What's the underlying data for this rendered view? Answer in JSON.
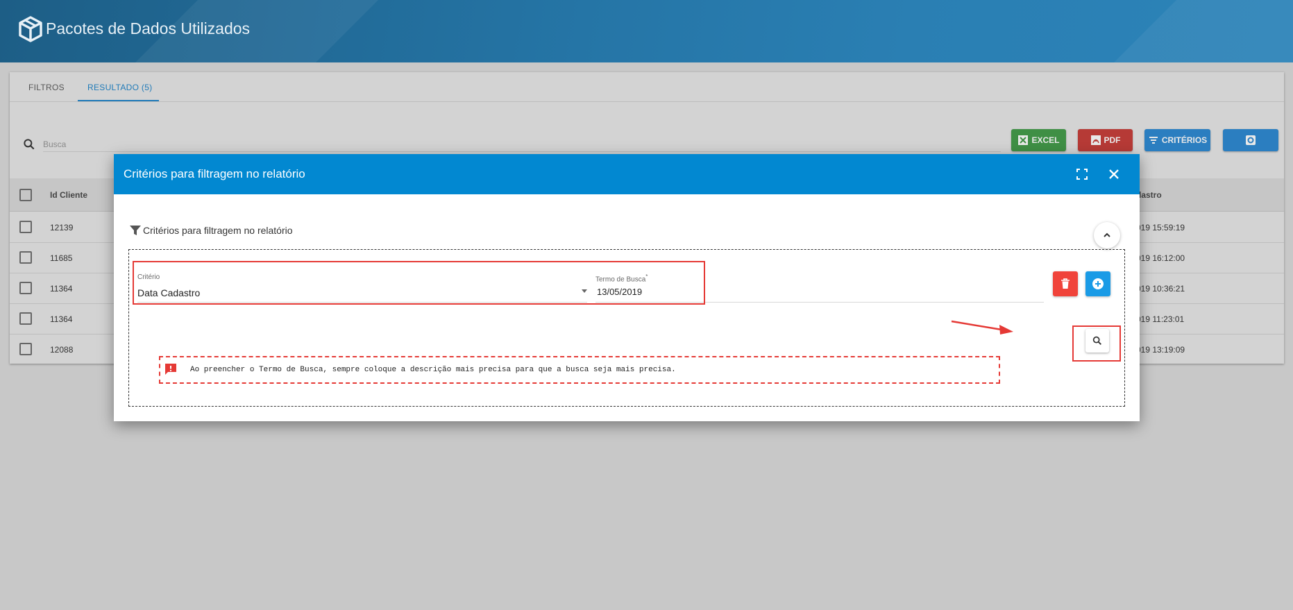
{
  "header": {
    "title": "Pacotes de Dados Utilizados",
    "logo_icon": "box-icon"
  },
  "tabs": [
    {
      "label": "FILTROS",
      "active": false
    },
    {
      "label": "RESULTADO (5)",
      "active": true
    }
  ],
  "search": {
    "placeholder": "Busca"
  },
  "toolbar": {
    "excel_label": "EXCEL",
    "pdf_label": "PDF",
    "criterios_label": "CRITÉRIOS",
    "colors": {
      "excel": "#3f8f45",
      "pdf": "#b63a36",
      "primary": "#2b7ec0"
    }
  },
  "table": {
    "columns": [
      "Id Cliente",
      "dastro"
    ],
    "rows": [
      {
        "id": "12139",
        "date": "019 15:59:19"
      },
      {
        "id": "11685",
        "date": "019 16:12:00"
      },
      {
        "id": "11364",
        "date": "019 10:36:21"
      },
      {
        "id": "11364",
        "date": "019 11:23:01"
      },
      {
        "id": "12088",
        "date": "019 13:19:09"
      }
    ]
  },
  "modal": {
    "title": "Critérios para filtragem no relatório",
    "section_title": "Critérios para filtragem no relatório",
    "criterio_label": "Critério",
    "criterio_value": "Data Cadastro",
    "termo_label": "Termo de Busca",
    "termo_required_mark": "*",
    "termo_value": "13/05/2019",
    "hint": "Ao preencher o Termo de Busca, sempre coloque a descrição mais precisa para que a busca seja mais precisa.",
    "colors": {
      "header": "#0288d1",
      "highlight": "#e53935",
      "delete": "#f0433a",
      "add": "#1a9be6"
    }
  }
}
